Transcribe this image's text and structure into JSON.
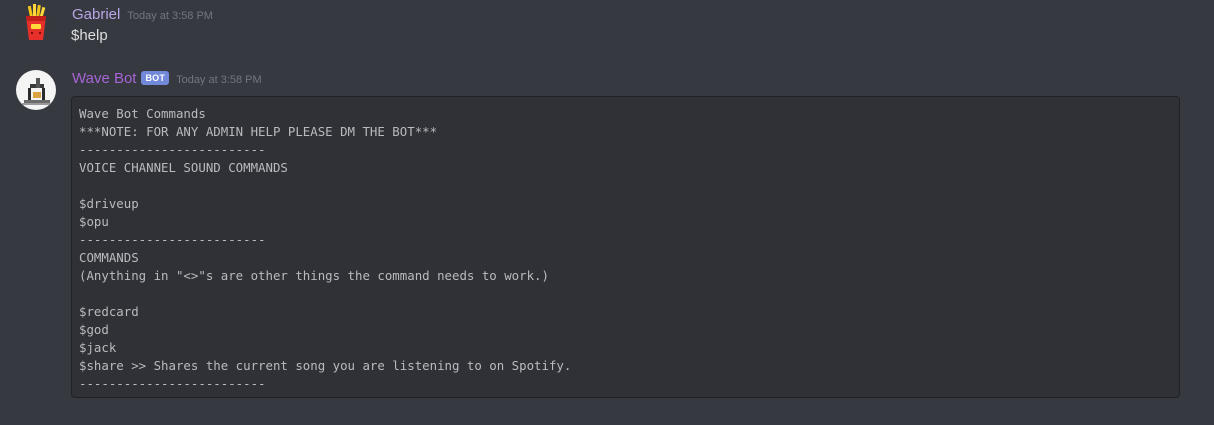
{
  "messages": [
    {
      "author": "Gabriel",
      "timestamp": "Today at 3:58 PM",
      "text": "$help",
      "avatar_icon": "fries-icon"
    },
    {
      "author": "Wave Bot",
      "bot_tag": "BOT",
      "timestamp": "Today at 3:58 PM",
      "avatar_icon": "bot-avatar-icon",
      "code_lines": [
        "Wave Bot Commands",
        "***NOTE: FOR ANY ADMIN HELP PLEASE DM THE BOT***",
        "-------------------------",
        "VOICE CHANNEL SOUND COMMANDS",
        "",
        "$driveup",
        "$opu",
        "-------------------------",
        "COMMANDS",
        "(Anything in \"<>\"s are other things the command needs to work.)",
        "",
        "$redcard",
        "$god",
        "$jack",
        "$share >> Shares the current song you are listening to on Spotify.",
        "-------------------------"
      ]
    }
  ],
  "colors": {
    "background": "#36393f",
    "code_background": "#2f3136",
    "gabriel_name": "#b9a6e6",
    "wave_bot_name": "#a664d6",
    "bot_tag": "#7289da",
    "timestamp": "#72767d",
    "text": "#dcddde"
  }
}
